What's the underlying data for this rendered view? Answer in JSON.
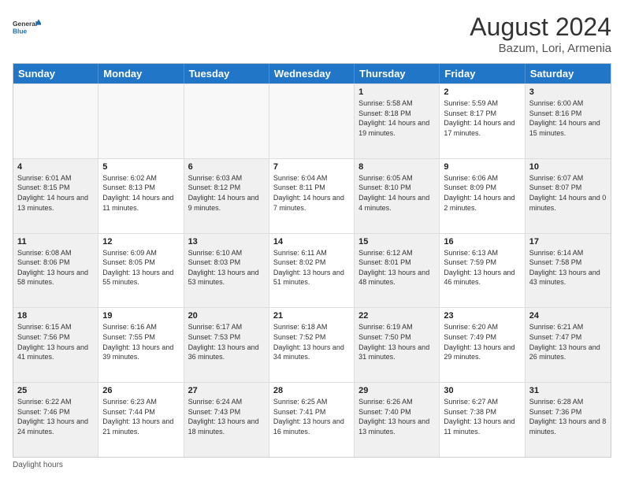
{
  "logo": {
    "line1": "General",
    "line2": "Blue"
  },
  "title": "August 2024",
  "location": "Bazum, Lori, Armenia",
  "weekdays": [
    "Sunday",
    "Monday",
    "Tuesday",
    "Wednesday",
    "Thursday",
    "Friday",
    "Saturday"
  ],
  "rows": [
    [
      {
        "day": "",
        "empty": true
      },
      {
        "day": "",
        "empty": true
      },
      {
        "day": "",
        "empty": true
      },
      {
        "day": "",
        "empty": true
      },
      {
        "day": "1",
        "sunrise": "Sunrise: 5:58 AM",
        "sunset": "Sunset: 8:18 PM",
        "daylight": "Daylight: 14 hours and 19 minutes."
      },
      {
        "day": "2",
        "sunrise": "Sunrise: 5:59 AM",
        "sunset": "Sunset: 8:17 PM",
        "daylight": "Daylight: 14 hours and 17 minutes."
      },
      {
        "day": "3",
        "sunrise": "Sunrise: 6:00 AM",
        "sunset": "Sunset: 8:16 PM",
        "daylight": "Daylight: 14 hours and 15 minutes."
      }
    ],
    [
      {
        "day": "4",
        "sunrise": "Sunrise: 6:01 AM",
        "sunset": "Sunset: 8:15 PM",
        "daylight": "Daylight: 14 hours and 13 minutes."
      },
      {
        "day": "5",
        "sunrise": "Sunrise: 6:02 AM",
        "sunset": "Sunset: 8:13 PM",
        "daylight": "Daylight: 14 hours and 11 minutes."
      },
      {
        "day": "6",
        "sunrise": "Sunrise: 6:03 AM",
        "sunset": "Sunset: 8:12 PM",
        "daylight": "Daylight: 14 hours and 9 minutes."
      },
      {
        "day": "7",
        "sunrise": "Sunrise: 6:04 AM",
        "sunset": "Sunset: 8:11 PM",
        "daylight": "Daylight: 14 hours and 7 minutes."
      },
      {
        "day": "8",
        "sunrise": "Sunrise: 6:05 AM",
        "sunset": "Sunset: 8:10 PM",
        "daylight": "Daylight: 14 hours and 4 minutes."
      },
      {
        "day": "9",
        "sunrise": "Sunrise: 6:06 AM",
        "sunset": "Sunset: 8:09 PM",
        "daylight": "Daylight: 14 hours and 2 minutes."
      },
      {
        "day": "10",
        "sunrise": "Sunrise: 6:07 AM",
        "sunset": "Sunset: 8:07 PM",
        "daylight": "Daylight: 14 hours and 0 minutes."
      }
    ],
    [
      {
        "day": "11",
        "sunrise": "Sunrise: 6:08 AM",
        "sunset": "Sunset: 8:06 PM",
        "daylight": "Daylight: 13 hours and 58 minutes."
      },
      {
        "day": "12",
        "sunrise": "Sunrise: 6:09 AM",
        "sunset": "Sunset: 8:05 PM",
        "daylight": "Daylight: 13 hours and 55 minutes."
      },
      {
        "day": "13",
        "sunrise": "Sunrise: 6:10 AM",
        "sunset": "Sunset: 8:03 PM",
        "daylight": "Daylight: 13 hours and 53 minutes."
      },
      {
        "day": "14",
        "sunrise": "Sunrise: 6:11 AM",
        "sunset": "Sunset: 8:02 PM",
        "daylight": "Daylight: 13 hours and 51 minutes."
      },
      {
        "day": "15",
        "sunrise": "Sunrise: 6:12 AM",
        "sunset": "Sunset: 8:01 PM",
        "daylight": "Daylight: 13 hours and 48 minutes."
      },
      {
        "day": "16",
        "sunrise": "Sunrise: 6:13 AM",
        "sunset": "Sunset: 7:59 PM",
        "daylight": "Daylight: 13 hours and 46 minutes."
      },
      {
        "day": "17",
        "sunrise": "Sunrise: 6:14 AM",
        "sunset": "Sunset: 7:58 PM",
        "daylight": "Daylight: 13 hours and 43 minutes."
      }
    ],
    [
      {
        "day": "18",
        "sunrise": "Sunrise: 6:15 AM",
        "sunset": "Sunset: 7:56 PM",
        "daylight": "Daylight: 13 hours and 41 minutes."
      },
      {
        "day": "19",
        "sunrise": "Sunrise: 6:16 AM",
        "sunset": "Sunset: 7:55 PM",
        "daylight": "Daylight: 13 hours and 39 minutes."
      },
      {
        "day": "20",
        "sunrise": "Sunrise: 6:17 AM",
        "sunset": "Sunset: 7:53 PM",
        "daylight": "Daylight: 13 hours and 36 minutes."
      },
      {
        "day": "21",
        "sunrise": "Sunrise: 6:18 AM",
        "sunset": "Sunset: 7:52 PM",
        "daylight": "Daylight: 13 hours and 34 minutes."
      },
      {
        "day": "22",
        "sunrise": "Sunrise: 6:19 AM",
        "sunset": "Sunset: 7:50 PM",
        "daylight": "Daylight: 13 hours and 31 minutes."
      },
      {
        "day": "23",
        "sunrise": "Sunrise: 6:20 AM",
        "sunset": "Sunset: 7:49 PM",
        "daylight": "Daylight: 13 hours and 29 minutes."
      },
      {
        "day": "24",
        "sunrise": "Sunrise: 6:21 AM",
        "sunset": "Sunset: 7:47 PM",
        "daylight": "Daylight: 13 hours and 26 minutes."
      }
    ],
    [
      {
        "day": "25",
        "sunrise": "Sunrise: 6:22 AM",
        "sunset": "Sunset: 7:46 PM",
        "daylight": "Daylight: 13 hours and 24 minutes."
      },
      {
        "day": "26",
        "sunrise": "Sunrise: 6:23 AM",
        "sunset": "Sunset: 7:44 PM",
        "daylight": "Daylight: 13 hours and 21 minutes."
      },
      {
        "day": "27",
        "sunrise": "Sunrise: 6:24 AM",
        "sunset": "Sunset: 7:43 PM",
        "daylight": "Daylight: 13 hours and 18 minutes."
      },
      {
        "day": "28",
        "sunrise": "Sunrise: 6:25 AM",
        "sunset": "Sunset: 7:41 PM",
        "daylight": "Daylight: 13 hours and 16 minutes."
      },
      {
        "day": "29",
        "sunrise": "Sunrise: 6:26 AM",
        "sunset": "Sunset: 7:40 PM",
        "daylight": "Daylight: 13 hours and 13 minutes."
      },
      {
        "day": "30",
        "sunrise": "Sunrise: 6:27 AM",
        "sunset": "Sunset: 7:38 PM",
        "daylight": "Daylight: 13 hours and 11 minutes."
      },
      {
        "day": "31",
        "sunrise": "Sunrise: 6:28 AM",
        "sunset": "Sunset: 7:36 PM",
        "daylight": "Daylight: 13 hours and 8 minutes."
      }
    ]
  ],
  "footer": "Daylight hours"
}
